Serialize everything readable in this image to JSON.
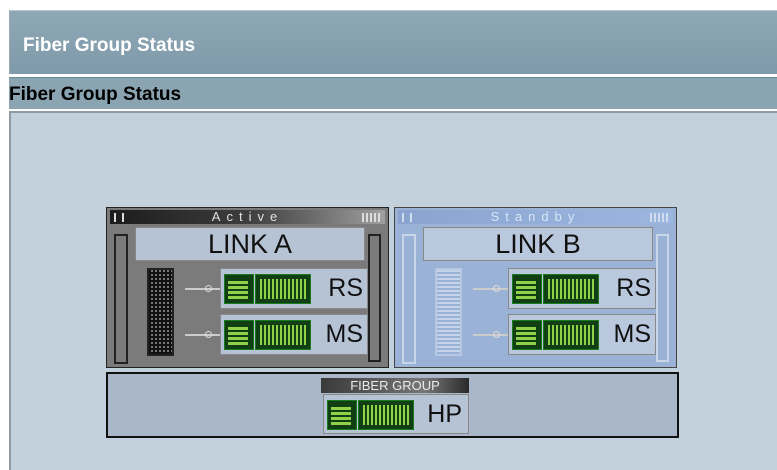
{
  "header": {
    "title": "Fiber Group Status"
  },
  "section": {
    "title": "Fiber Group Status"
  },
  "links": [
    {
      "state": "Active",
      "name": "LINK A",
      "channels": [
        "RS",
        "MS"
      ]
    },
    {
      "state": "Standby",
      "name": "LINK B",
      "channels": [
        "RS",
        "MS"
      ]
    }
  ],
  "fiber_group": {
    "title": "FIBER GROUP",
    "channel": "HP"
  },
  "colors": {
    "active_bg": "#7b7b7b",
    "standby_bg": "#9ab2d6",
    "signal": "#8fd24a"
  }
}
